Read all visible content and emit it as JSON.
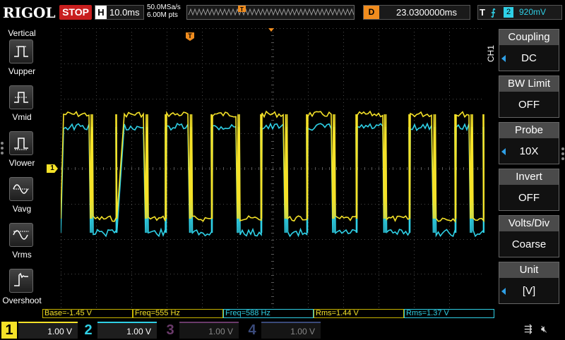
{
  "topbar": {
    "logo": "RIGOL",
    "run_state": "STOP",
    "horizontal_key": "H",
    "timebase": "10.0ms",
    "sample_rate": "50.0MSa/s",
    "memory_depth": "6.00M pts",
    "trigger_marker": "T",
    "delay_key": "D",
    "delay_value": "23.0300000ms",
    "trigger_key": "T",
    "trigger_edge": "rising-edge-icon",
    "trigger_source": "2",
    "trigger_level": "920mV"
  },
  "left_panel": {
    "title": "Vertical",
    "items": [
      {
        "label": "Vupper",
        "icon": "vupper-icon"
      },
      {
        "label": "Vmid",
        "icon": "vmid-icon"
      },
      {
        "label": "Vlower",
        "icon": "vlower-icon"
      },
      {
        "label": "Vavg",
        "icon": "vavg-icon"
      },
      {
        "label": "Vrms",
        "icon": "vrms-icon"
      },
      {
        "label": "Overshoot",
        "icon": "overshoot-icon"
      }
    ]
  },
  "screen": {
    "trigger_pos_marker": "T",
    "ch1_offset_marker": "1",
    "trigger_level_marker": "T"
  },
  "right_menu": {
    "channel_tag": "CH1",
    "items": [
      {
        "title": "Coupling",
        "value": "DC"
      },
      {
        "title": "BW Limit",
        "value": "OFF"
      },
      {
        "title": "Probe",
        "value": "10X"
      },
      {
        "title": "Invert",
        "value": "OFF"
      },
      {
        "title": "Volts/Div",
        "value": "Coarse"
      },
      {
        "title": "Unit",
        "value": "[V]"
      }
    ]
  },
  "measurements": [
    {
      "text": "Base=-1.45 V",
      "channel": "1"
    },
    {
      "text": "Freq=555 Hz",
      "channel": "1"
    },
    {
      "text": "Freq=588 Hz",
      "channel": "2"
    },
    {
      "text": "Rms=1.44 V",
      "channel": "1"
    },
    {
      "text": "Rms=1.37 V",
      "channel": "2"
    }
  ],
  "bottom_bar": {
    "channels": [
      {
        "num": "1",
        "scale": "1.00 V",
        "active": true
      },
      {
        "num": "2",
        "scale": "1.00 V",
        "active": true
      },
      {
        "num": "3",
        "scale": "1.00 V",
        "active": false
      },
      {
        "num": "4",
        "scale": "1.00 V",
        "active": false
      }
    ],
    "usb_icon": "usb-icon",
    "speaker_icon": "speaker-muted-icon"
  },
  "colors": {
    "ch1": "#f5e228",
    "ch2": "#2fd0e6",
    "ch3": "#d23cd2",
    "ch4": "#3c64f0",
    "stop": "#c81e1e",
    "trigger": "#f08c1e",
    "grid": "#3c3c3c"
  }
}
